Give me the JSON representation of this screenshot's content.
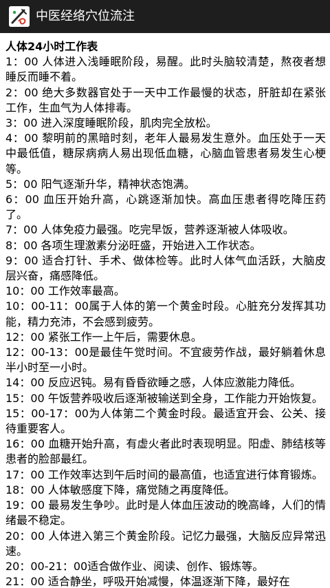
{
  "app": {
    "title": "中医经络穴位流注",
    "icon": "app-logo-icon"
  },
  "article": {
    "heading": "人体24小时工作表",
    "entries": [
      "1：00 人体进入浅睡眠阶段，易醒。此时头脑较清楚，熬夜者想睡反而睡不着。",
      "2：00 绝大多数器官处于一天中工作最慢的状态，肝脏却在紧张工作，生血气为人体排毒。",
      "3：00 进入深度睡眠阶段，肌肉完全放松。",
      "4：00 黎明前的黑暗时刻，老年人最易发生意外。血压处于一天中最低值，糖尿病病人易出现低血糖，心脑血管患者易发生心梗等。",
      "5：00 阳气逐渐升华，精神状态饱满。",
      "6：00 血压开始升高，心跳逐渐加快。高血压患者得吃降压药了。",
      "7：00 人体免疫力最强。吃完早饭，营养逐渐被人体吸收。",
      "8：00 各项生理激素分泌旺盛，开始进入工作状态。",
      "9：00 适合打针、手术、做体检等。此时人体气血活跃，大脑皮层兴奋，痛感降低。",
      "10：00 工作效率最高。",
      "10：00-11：00属于人体的第一个黄金时段。心脏充分发挥其功能，精力充沛，不会感到疲劳。",
      "12：00 紧张工作一上午后，需要休息。",
      "12：00-13：00是最佳午觉时间。不宜疲劳作战，最好躺着休息半小时至一小时。",
      "14：00 反应迟钝。易有昏昏欲睡之感，人体应激能力降低。",
      "15：00 午饭营养吸收后逐渐被输送到全身，工作能力开始恢复。",
      "15：00-17：00为人体第二个黄金时段。最适宜开会、公关、接待重要客人。",
      "16：00 血糖开始升高，有虚火者此时表现明显。阳虚、肺结核等患者的脸部最红。",
      "17：00 工作效率达到午后时间的最高值，也适宜进行体育锻炼。",
      "18：00 人体敏感度下降，痛觉随之再度降低。",
      "19：00 最易发生争吵。此时是人体血压波动的晚高峰，人们的情绪最不稳定。",
      "20：00 人体进入第三个黄金阶段。记忆力最强，大脑反应异常迅速。",
      "20：00-21：00适合做作业、阅读、创作、锻炼等。",
      "21：00 适合静坐，呼吸开始减慢，体温逐渐下降，最好在"
    ]
  }
}
